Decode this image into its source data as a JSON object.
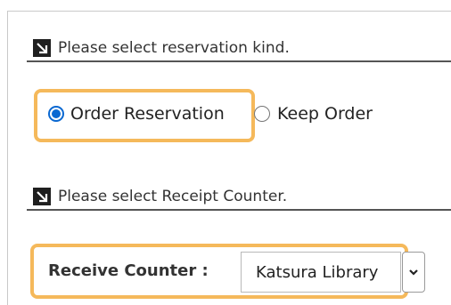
{
  "reservation": {
    "heading": "Please select reservation kind.",
    "options": [
      {
        "label": "Order Reservation",
        "selected": true
      },
      {
        "label": "Keep Order",
        "selected": false
      }
    ]
  },
  "receipt": {
    "heading": "Please select Receipt Counter.",
    "counter_label": "Receive Counter :",
    "counter_value": "Katsura Library"
  },
  "colors": {
    "highlight": "#f5b95b",
    "radio_selected": "#0a68d1",
    "heading_rule": "#555555"
  },
  "icons": {
    "section_arrow": "arrow-down-right-icon",
    "dropdown": "chevron-down-icon"
  }
}
